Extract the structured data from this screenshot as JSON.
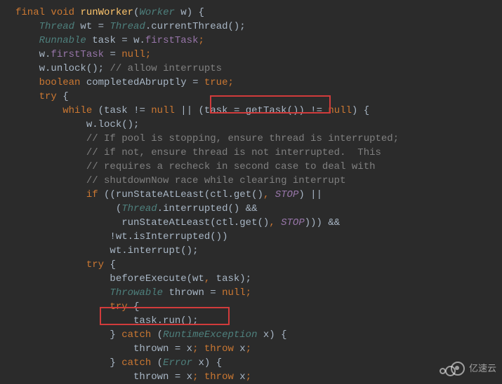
{
  "code": {
    "l01": {
      "a": "final ",
      "b": "void ",
      "c": "runWorker",
      "d": "(",
      "e": "Worker ",
      "f": "w",
      "g": ") {"
    },
    "l02": {
      "a": "    ",
      "b": "Thread ",
      "c": "wt ",
      "d": "= ",
      "e": "Thread",
      "f": ".",
      "g": "currentThread",
      "h": "();"
    },
    "l03": {
      "a": "    ",
      "b": "Runnable ",
      "c": "task ",
      "d": "= ",
      "e": "w",
      "f": ".",
      "g": "firstTask",
      "h": ";"
    },
    "l04": {
      "a": "    ",
      "b": "w",
      "c": ".",
      "d": "firstTask ",
      "e": "= ",
      "f": "null",
      "g": ";"
    },
    "l05": {
      "a": "    ",
      "b": "w",
      "c": ".",
      "d": "unlock",
      "e": "(); ",
      "f": "// allow interrupts"
    },
    "l06": {
      "a": "    ",
      "b": "boolean ",
      "c": "completedAbruptly ",
      "d": "= ",
      "e": "true",
      "f": ";"
    },
    "l07": {
      "a": "    ",
      "b": "try ",
      "c": "{"
    },
    "l08": {
      "a": "        ",
      "b": "while ",
      "c": "(task ",
      "d": "!= ",
      "e": "null ",
      "f": "|| ",
      "g": "(task ",
      "h": "= ",
      "i": "getTask",
      "j": "()) ",
      "k": "!= ",
      "l": "null",
      "m": ") {"
    },
    "l09": {
      "a": "            ",
      "b": "w",
      "c": ".",
      "d": "lock",
      "e": "();"
    },
    "l10": {
      "a": "            ",
      "b": "// If pool is stopping, ensure thread is interrupted;"
    },
    "l11": {
      "a": "            ",
      "b": "// if not, ensure thread is not interrupted.  This"
    },
    "l12": {
      "a": "            ",
      "b": "// requires a recheck in second case to deal with"
    },
    "l13": {
      "a": "            ",
      "b": "// shutdownNow race while clearing interrupt"
    },
    "l14": {
      "a": "            ",
      "b": "if ",
      "c": "((",
      "d": "runStateAtLeast",
      "e": "(ctl",
      "f": ".",
      "g": "get",
      "h": "()",
      "i": ", ",
      "j": "STOP",
      "k": ") ",
      "l": "||"
    },
    "l15": {
      "a": "                 ",
      "b": "(",
      "c": "Thread",
      "d": ".",
      "e": "interrupted",
      "f": "() ",
      "g": "&&"
    },
    "l16": {
      "a": "                  ",
      "b": "runStateAtLeast",
      "c": "(ctl",
      "d": ".",
      "e": "get",
      "f": "()",
      "g": ", ",
      "h": "STOP",
      "i": "))) ",
      "j": "&&"
    },
    "l17": {
      "a": "                ",
      "b": "!",
      "c": "wt",
      "d": ".",
      "e": "isInterrupted",
      "f": "())"
    },
    "l18": {
      "a": "                ",
      "b": "wt",
      "c": ".",
      "d": "interrupt",
      "e": "();"
    },
    "l19": {
      "a": "            ",
      "b": "try ",
      "c": "{"
    },
    "l20": {
      "a": "                ",
      "b": "beforeExecute",
      "c": "(wt",
      "d": ", ",
      "e": "task);"
    },
    "l21": {
      "a": "                ",
      "b": "Throwable ",
      "c": "thrown ",
      "d": "= ",
      "e": "null",
      "f": ";"
    },
    "l22": {
      "a": "                ",
      "b": "try ",
      "c": "{"
    },
    "l23": {
      "a": "                    ",
      "b": "task",
      "c": ".",
      "d": "run",
      "e": "();"
    },
    "l24": {
      "a": "                ",
      "b": "} ",
      "c": "catch ",
      "d": "(",
      "e": "RuntimeException ",
      "f": "x",
      "g": ") {"
    },
    "l25": {
      "a": "                    ",
      "b": "thrown ",
      "c": "= ",
      "d": "x",
      "e": "; ",
      "f": "throw ",
      "g": "x",
      "h": ";"
    },
    "l26": {
      "a": "                ",
      "b": "} ",
      "c": "catch ",
      "d": "(",
      "e": "Error ",
      "f": "x",
      "g": ") {"
    },
    "l27": {
      "a": "                    ",
      "b": "thrown ",
      "c": "= ",
      "d": "x",
      "e": "; ",
      "f": "throw ",
      "g": "x",
      "h": ";"
    }
  },
  "watermark": "亿速云"
}
